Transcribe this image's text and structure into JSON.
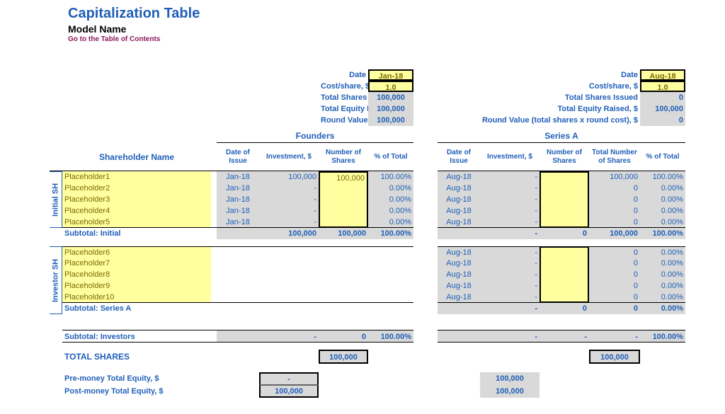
{
  "header": {
    "title": "Capitalization Table",
    "subtitle": "Model Name",
    "toc": "Go to the Table of Contents"
  },
  "labels": {
    "date": "Date",
    "costshare": "Cost/share, $",
    "tsi": "Total Shares Issued",
    "ter": "Total Equity Raised, $",
    "rv": "Round Value (total shares x round cost), $",
    "founders": "Founders",
    "seriesA": "Series A",
    "shname": "Shareholder Name",
    "doi": "Date of Issue",
    "inv": "Investment, $",
    "nos": "Number of Shares",
    "tnos": "Total Number of Shares",
    "pct": "% of Total",
    "initialSH": "Initial SH",
    "investorSH": "Investor SH",
    "subInitial": "Subtotal: Initial",
    "subSeriesA": "Subtotal: Series A",
    "subInvestors": "Subtotal: Investors",
    "totalShares": "TOTAL SHARES",
    "premoney": "Pre-money Total Equity, $",
    "postmoney": "Post-money Total Equity, $"
  },
  "rounds": {
    "founders": {
      "date": "Jan-18",
      "cost": "1.0",
      "tsi": "100,000",
      "ter": "100,000",
      "rv": "100,000"
    },
    "seriesA": {
      "date": "Aug-18",
      "cost": "1.0",
      "tsi": "0",
      "ter": "100,000",
      "rv": "0"
    }
  },
  "initial": [
    {
      "name": "Placeholder1",
      "f_date": "Jan-18",
      "f_inv": "100,000",
      "f_shares": "100,000",
      "f_pct": "100.00%",
      "a_date": "Aug-18",
      "a_inv": "-",
      "a_shares": "",
      "a_tot": "100,000",
      "a_pct": "100.00%"
    },
    {
      "name": "Placeholder2",
      "f_date": "Jan-18",
      "f_inv": "-",
      "f_shares": "",
      "f_pct": "0.00%",
      "a_date": "Aug-18",
      "a_inv": "-",
      "a_shares": "",
      "a_tot": "0",
      "a_pct": "0.00%"
    },
    {
      "name": "Placeholder3",
      "f_date": "Jan-18",
      "f_inv": "-",
      "f_shares": "",
      "f_pct": "0.00%",
      "a_date": "Aug-18",
      "a_inv": "-",
      "a_shares": "",
      "a_tot": "0",
      "a_pct": "0.00%"
    },
    {
      "name": "Placeholder4",
      "f_date": "Jan-18",
      "f_inv": "-",
      "f_shares": "",
      "f_pct": "0.00%",
      "a_date": "Aug-18",
      "a_inv": "-",
      "a_shares": "",
      "a_tot": "0",
      "a_pct": "0.00%"
    },
    {
      "name": "Placeholder5",
      "f_date": "Jan-18",
      "f_inv": "-",
      "f_shares": "",
      "f_pct": "0.00%",
      "a_date": "Aug-18",
      "a_inv": "-",
      "a_shares": "",
      "a_tot": "0",
      "a_pct": "0.00%"
    }
  ],
  "subInitial": {
    "f_inv": "100,000",
    "f_shares": "100,000",
    "f_pct": "100.00%",
    "a_inv": "-",
    "a_shares": "0",
    "a_tot": "100,000",
    "a_pct": "100.00%"
  },
  "investors": [
    {
      "name": "Placeholder6",
      "a_date": "Aug-18",
      "a_inv": "-",
      "a_shares": "",
      "a_tot": "0",
      "a_pct": "0.00%"
    },
    {
      "name": "Placeholder7",
      "a_date": "Aug-18",
      "a_inv": "-",
      "a_shares": "",
      "a_tot": "0",
      "a_pct": "0.00%"
    },
    {
      "name": "Placeholder8",
      "a_date": "Aug-18",
      "a_inv": "-",
      "a_shares": "",
      "a_tot": "0",
      "a_pct": "0.00%"
    },
    {
      "name": "Placeholder9",
      "a_date": "Aug-18",
      "a_inv": "-",
      "a_shares": "",
      "a_tot": "0",
      "a_pct": "0.00%"
    },
    {
      "name": "Placeholder10",
      "a_date": "Aug-18",
      "a_inv": "-",
      "a_shares": "",
      "a_tot": "0",
      "a_pct": "0.00%"
    }
  ],
  "subSeriesA": {
    "a_inv": "-",
    "a_shares": "0",
    "a_tot": "0",
    "a_pct": "0.00%"
  },
  "subInvestors": {
    "f_inv": "-",
    "f_shares": "0",
    "f_pct": "100.00%",
    "a_inv": "-",
    "a_shares": "-",
    "a_tot": "-",
    "a_pct": "100.00%"
  },
  "totals": {
    "f_total_shares": "100,000",
    "a_total_shares": "100,000",
    "f_pre": "-",
    "f_post": "100,000",
    "a_pre": "100,000",
    "a_post": "100,000"
  }
}
